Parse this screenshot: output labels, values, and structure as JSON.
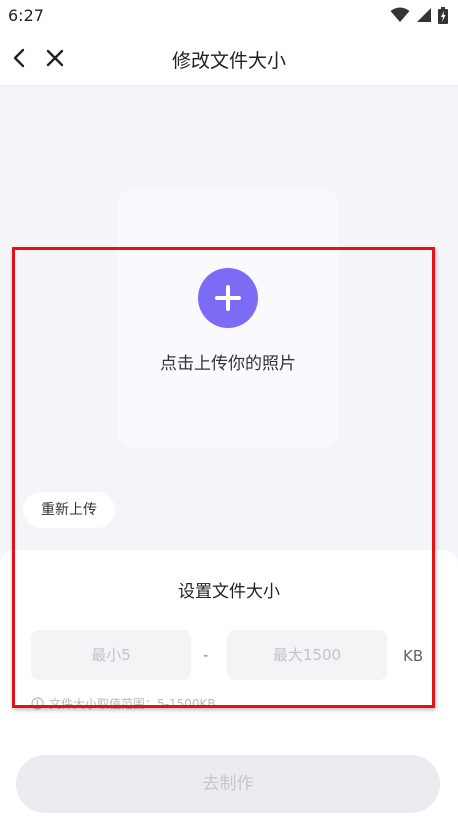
{
  "status_bar": {
    "time": "6:27",
    "icons": [
      "wifi-icon",
      "signal-icon",
      "battery-icon"
    ]
  },
  "nav": {
    "title": "修改文件大小",
    "back_icon": "chevron-left-icon",
    "close_icon": "close-icon"
  },
  "upload": {
    "label": "点击上传你的照片",
    "icon": "plus-icon",
    "accent_color": "#7c6cf5"
  },
  "reupload": {
    "label": "重新上传"
  },
  "settings": {
    "title": "设置文件大小",
    "min_placeholder": "最小5",
    "max_placeholder": "最大1500",
    "separator": "-",
    "unit": "KB",
    "hint": "文件大小取值范围：5-1500KB"
  },
  "action": {
    "label": "去制作"
  },
  "highlight_color": "#e0131b"
}
